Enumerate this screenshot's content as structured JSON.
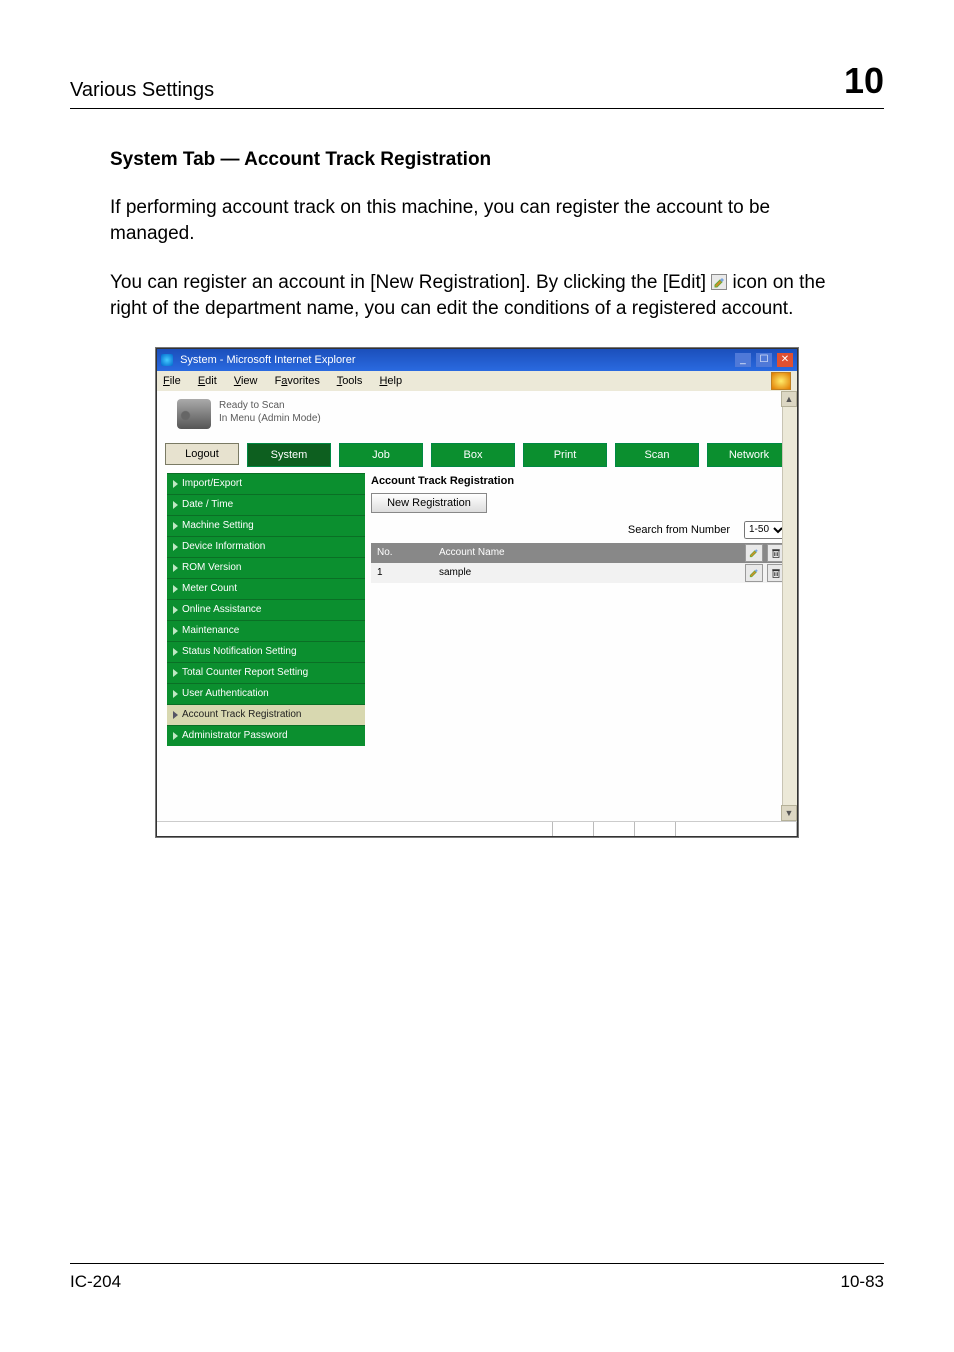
{
  "header": {
    "section": "Various Settings",
    "chapter_number": "10"
  },
  "subheading": "System Tab — Account Track Registration",
  "paragraph1": "If performing account track on this machine, you can register the account to be managed.",
  "paragraph2a": "You can register an account in [New Registration]. By clicking the [Edit] ",
  "paragraph2b": " icon on the right of the department name, you can edit the conditions of a registered account.",
  "footer": {
    "left": "IC-204",
    "right": "10-83"
  },
  "ie": {
    "title": "System - Microsoft Internet Explorer",
    "winbtn_min": "_",
    "winbtn_max": "☐",
    "winbtn_close": "✕",
    "menu": {
      "file": "File",
      "edit": "Edit",
      "view": "View",
      "favorites": "Favorites",
      "tools": "Tools",
      "help": "Help"
    },
    "status": {
      "line1": "Ready to Scan",
      "line2": "In Menu (Admin Mode)"
    },
    "logout": "Logout",
    "tabs": {
      "system": "System",
      "job": "Job",
      "box": "Box",
      "print": "Print",
      "scan": "Scan",
      "network": "Network"
    },
    "side": {
      "import_export": "Import/Export",
      "date_time": "Date / Time",
      "machine_setting": "Machine Setting",
      "device_info": "Device Information",
      "rom_version": "ROM Version",
      "meter_count": "Meter Count",
      "online_assist": "Online Assistance",
      "maintenance": "Maintenance",
      "status_notif": "Status Notification Setting",
      "total_counter": "Total Counter Report Setting",
      "user_auth": "User Authentication",
      "acct_track": "Account Track Registration",
      "admin_pwd": "Administrator Password"
    },
    "main": {
      "heading": "Account Track Registration",
      "new_reg": "New Registration",
      "search_label": "Search from Number",
      "search_option": "1-50",
      "col_no": "No.",
      "col_name": "Account Name",
      "row1_no": "1",
      "row1_name": "sample"
    }
  }
}
